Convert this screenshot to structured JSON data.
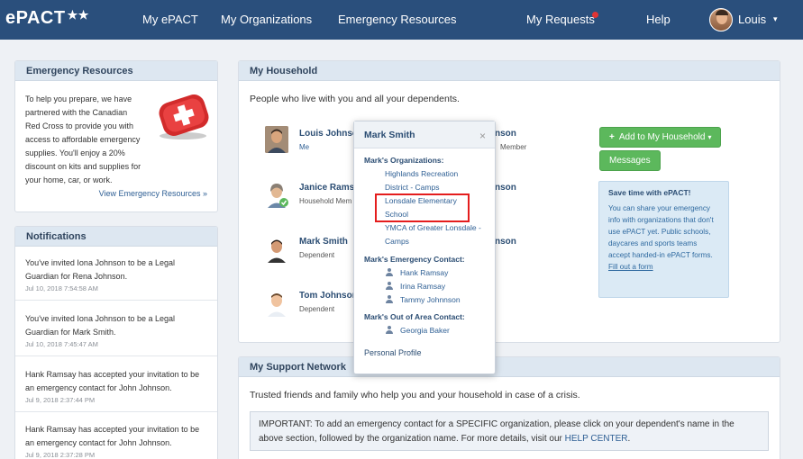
{
  "nav": {
    "logo": "ePACT",
    "links": [
      "My ePACT",
      "My Organizations",
      "Emergency Resources",
      "My Requests",
      "Help"
    ],
    "user": "Louis",
    "notify_color": "#e03434"
  },
  "emergency": {
    "title": "Emergency Resources",
    "text": "To help you prepare, we have partnered with the Canadian Red Cross to provide you with access to affordable emergency supplies. You'll enjoy a 20% discount on kits and supplies for your home, car, or work.",
    "link": "View Emergency Resources »"
  },
  "notifications": {
    "title": "Notifications",
    "items": [
      {
        "msg": "You've invited Iona Johnson to be a Legal Guardian for Rena Johnson.",
        "ts": "Jul 10, 2018 7:54:58 AM"
      },
      {
        "msg": "You've invited Iona Johnson to be a Legal Guardian for Mark Smith.",
        "ts": "Jul 10, 2018 7:45:47 AM"
      },
      {
        "msg": "Hank Ramsay has accepted your invitation to be an emergency contact for John Johnson.",
        "ts": "Jul 9, 2018 2:37:44 PM"
      },
      {
        "msg": "Hank Ramsay has accepted your invitation to be an emergency contact for John Johnson.",
        "ts": "Jul 9, 2018 2:37:28 PM"
      }
    ]
  },
  "household": {
    "title": "My Household",
    "intro": "People who live with you and all your dependents.",
    "members": [
      {
        "name": "Louis Johnso",
        "role": "Me"
      },
      {
        "name": "Janice Rams",
        "role": "Household Mem"
      },
      {
        "name": "Mark Smith",
        "role": "Dependent"
      },
      {
        "name": "Tom Johnson",
        "role": "Dependent"
      }
    ],
    "right_col": [
      {
        "name": "nson",
        "role": "Member"
      },
      {
        "name": "nson",
        "role": ""
      },
      {
        "name": "nson",
        "role": ""
      }
    ],
    "add_button": "Add to My Household",
    "messages_button": "Messages",
    "tip_title": "Save time with ePACT!",
    "tip_body": "You can share your emergency info with organizations that don't use ePACT yet. Public schools, daycares and sports teams accept handed-in ePACT forms.",
    "tip_link": "Fill out a form"
  },
  "support": {
    "title": "My Support Network",
    "text": "Trusted friends and family who help you and your household in case of a crisis.",
    "important_prefix": "IMPORTANT: To add an emergency contact for a SPECIFIC organization, please click on your dependent's name in the above section, followed by the organization name. For more details, visit our ",
    "important_link": "HELP CENTER",
    "important_suffix": "."
  },
  "popover": {
    "title": "Mark Smith",
    "orgs_label": "Mark's Organizations:",
    "orgs": [
      "Highlands Recreation District - Camps",
      "Lonsdale Elementary School",
      "YMCA of Greater Lonsdale - Camps"
    ],
    "emergency_label": "Mark's Emergency Contact:",
    "emergency": [
      "Hank Ramsay",
      "Irina Ramsay",
      "Tammy Johnnson"
    ],
    "outarea_label": "Mark's Out of Area Contact:",
    "outarea": [
      "Georgia Baker"
    ],
    "profile": "Personal Profile"
  }
}
